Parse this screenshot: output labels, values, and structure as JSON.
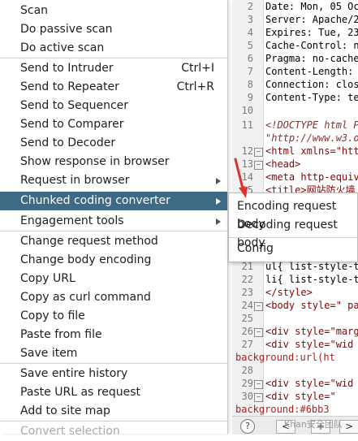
{
  "editor": {
    "lines": [
      {
        "n": "2",
        "t": "Date: Mon, 05 Oct"
      },
      {
        "n": "3",
        "t": "Server: Apache/2."
      },
      {
        "n": "4",
        "t": "Expires: Tue, 23 "
      },
      {
        "n": "5",
        "t": "Cache-Control: no"
      },
      {
        "n": "6",
        "t": "Pragma: no-cache"
      },
      {
        "n": "7",
        "t": "Content-Length: "
      },
      {
        "n": "8",
        "t": "Connection: close"
      },
      {
        "n": "9",
        "t": "Content-Type:  te"
      },
      {
        "n": "10",
        "t": ""
      },
      {
        "n": "11",
        "t": "<!DOCTYPE html P"
      },
      {
        "n": "",
        "t": "\"http://www.w3.o"
      },
      {
        "n": "12",
        "t": "<html xmlns=\"http"
      },
      {
        "n": "13",
        "t": "<head>"
      },
      {
        "n": "14",
        "t": "<meta http-equiv="
      },
      {
        "n": "15",
        "t": "<title>网站防火墙"
      },
      {
        "n": "21",
        "t": "ul{ list-style-ty"
      },
      {
        "n": "22",
        "t": "li{ list-style-ty"
      },
      {
        "n": "23",
        "t": "</style>"
      },
      {
        "n": "24",
        "t": "<body style=\" pad"
      },
      {
        "n": "25",
        "t": ""
      },
      {
        "n": "26",
        "t": " <div style=\"marg"
      },
      {
        "n": "27",
        "t": "  <div style=\"wid"
      },
      {
        "n": "",
        "t": "background:url(ht"
      },
      {
        "n": "28",
        "t": ""
      },
      {
        "n": "29",
        "t": "  <div style=\"wid"
      },
      {
        "n": "30",
        "t": "    <div style=\""
      },
      {
        "n": "",
        "t": "background:#6bb3"
      }
    ]
  },
  "menu": {
    "items": [
      {
        "label": "Scan"
      },
      {
        "label": "Do passive scan"
      },
      {
        "label": "Do active scan"
      },
      {
        "label": "Send to Intruder",
        "shortcut": "Ctrl+I"
      },
      {
        "label": "Send to Repeater",
        "shortcut": "Ctrl+R"
      },
      {
        "label": "Send to Sequencer"
      },
      {
        "label": "Send to Comparer"
      },
      {
        "label": "Send to Decoder"
      },
      {
        "label": "Show response in browser"
      },
      {
        "label": "Request in browser"
      },
      {
        "label": "Chunked coding converter"
      },
      {
        "label": "Engagement tools"
      },
      {
        "label": "Change request method"
      },
      {
        "label": "Change body encoding"
      },
      {
        "label": "Copy URL"
      },
      {
        "label": "Copy as curl command"
      },
      {
        "label": "Copy to file"
      },
      {
        "label": "Paste from file"
      },
      {
        "label": "Save item"
      },
      {
        "label": "Save entire history"
      },
      {
        "label": "Paste URL as request"
      },
      {
        "label": "Add to site map"
      },
      {
        "label": "Convert selection"
      }
    ]
  },
  "submenu": {
    "items": [
      {
        "label": "Encoding request body"
      },
      {
        "label": "Decoding request body"
      },
      {
        "label": "Config"
      }
    ]
  },
  "bottom": {
    "help": "?",
    "prev": "<",
    "add": "+",
    "next": ">",
    "watermark": "Khan安全团队"
  },
  "colors": {
    "active_bg": "#3f6a86",
    "annotation_arrow": "#e0312b"
  }
}
